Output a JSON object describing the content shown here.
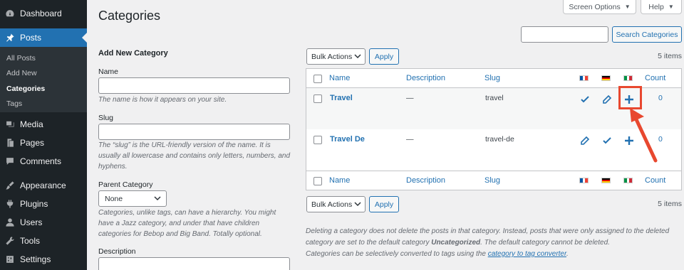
{
  "sidebar": {
    "items": [
      {
        "label": "Dashboard",
        "icon": "dashboard-icon"
      },
      {
        "label": "Posts",
        "icon": "pushpin-icon",
        "active": true
      },
      {
        "label": "Media",
        "icon": "media-icon"
      },
      {
        "label": "Pages",
        "icon": "pages-icon"
      },
      {
        "label": "Comments",
        "icon": "comments-icon"
      },
      {
        "label": "Appearance",
        "icon": "appearance-brush-icon"
      },
      {
        "label": "Plugins",
        "icon": "plugins-icon"
      },
      {
        "label": "Users",
        "icon": "users-icon"
      },
      {
        "label": "Tools",
        "icon": "tools-wrench-icon"
      },
      {
        "label": "Settings",
        "icon": "settings-icon"
      }
    ],
    "submenu": [
      {
        "label": "All Posts"
      },
      {
        "label": "Add New"
      },
      {
        "label": "Categories",
        "current": true
      },
      {
        "label": "Tags"
      }
    ]
  },
  "header": {
    "screen_options": "Screen Options",
    "help": "Help",
    "title": "Categories"
  },
  "search": {
    "value": "",
    "button": "Search Categories"
  },
  "form": {
    "heading": "Add New Category",
    "name_label": "Name",
    "name_help": "The name is how it appears on your site.",
    "slug_label": "Slug",
    "slug_help": "The “slug” is the URL-friendly version of the name. It is usually all lowercase and contains only letters, numbers, and hyphens.",
    "parent_label": "Parent Category",
    "parent_value": "None",
    "parent_help": "Categories, unlike tags, can have a hierarchy. You might have a Jazz category, and under that have children categories for Bebop and Big Band. Totally optional.",
    "description_label": "Description"
  },
  "bulk": {
    "select": "Bulk Actions",
    "apply": "Apply",
    "items_count": "5 items"
  },
  "table": {
    "columns": [
      "Name",
      "Description",
      "Slug",
      "Count"
    ],
    "flags": [
      "french-flag-icon",
      "german-flag-icon",
      "italian-flag-icon"
    ],
    "rows": [
      {
        "name": "Travel",
        "description": "—",
        "slug": "travel",
        "count": "0",
        "lang_actions": [
          "checkmark-icon",
          "pencil-icon",
          "plus-icon"
        ]
      },
      {
        "name": "Travel De",
        "description": "—",
        "slug": "travel-de",
        "count": "0",
        "lang_actions": [
          "pencil-icon",
          "checkmark-icon",
          "plus-icon"
        ]
      }
    ]
  },
  "notes": {
    "note1_before": "Deleting a category does not delete the posts in that category. Instead, posts that were only assigned to the deleted category are set to the default category ",
    "note1_bold": "Uncategorized",
    "note1_after": ". The default category cannot be deleted.",
    "note2_before": "Categories can be selectively converted to tags using the ",
    "note2_link": "category to tag converter",
    "note2_after": "."
  },
  "colors": {
    "sidebar_bg": "#1d2327",
    "accent": "#2271b1",
    "highlight": "#e8482f"
  }
}
